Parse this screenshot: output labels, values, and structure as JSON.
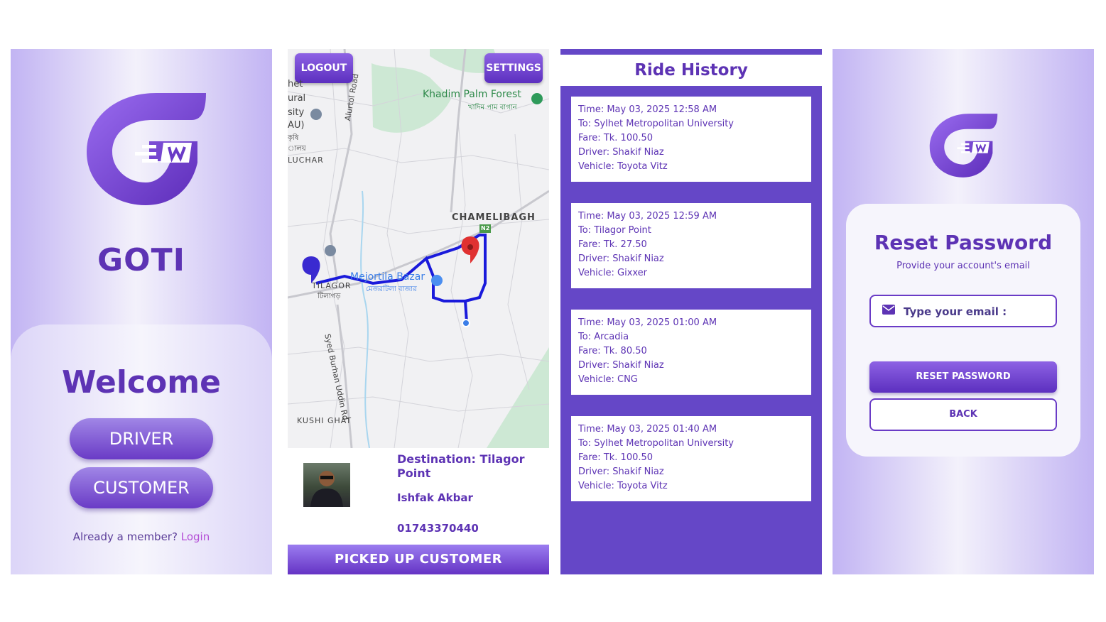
{
  "welcome_screen": {
    "brand": "GOTI",
    "heading": "Welcome",
    "driver_label": "DRIVER",
    "customer_label": "CUSTOMER",
    "member_prompt": "Already a member?",
    "login_link": "Login"
  },
  "map_screen": {
    "logout_label": "LOGOUT",
    "settings_label": "SETTINGS",
    "map_labels": {
      "forest": "Khadim Palm Forest",
      "forest_bn": "খাদিম পাম বাগান",
      "area1": "CHAMELIBAGH",
      "bazar": "Mejortila Bazar",
      "bazar_bn": "মেজরটিলা বাজার",
      "area2": "TILAGOR",
      "area2_bn": "টিলাগড়",
      "road1": "Alurtol Road",
      "road2": "Syed Burhan Uddin Rd",
      "area3": "KUSHI GHAT",
      "area4": "LUCHAR",
      "highway": "N2",
      "left_partial": [
        "het",
        "ural",
        "sity",
        "AU)",
        "কৃষি",
        "ালয়"
      ]
    },
    "destination": "Destination: Tilagor Point",
    "customer_name": "Ishfak Akbar",
    "phone": "01743370440",
    "pickup_label": "PICKED UP CUSTOMER"
  },
  "history_screen": {
    "title": "Ride History",
    "rides": [
      {
        "time": "Time: May 03, 2025 12:58 AM",
        "to": "To: Sylhet Metropolitan University",
        "fare": "Fare: Tk. 100.50",
        "driver": "Driver: Shakif Niaz",
        "vehicle": "Vehicle: Toyota Vitz"
      },
      {
        "time": "Time: May 03, 2025 12:59 AM",
        "to": "To: Tilagor Point",
        "fare": "Fare: Tk. 27.50",
        "driver": "Driver: Shakif Niaz",
        "vehicle": "Vehicle: Gixxer"
      },
      {
        "time": "Time: May 03, 2025 01:00 AM",
        "to": "To: Arcadia",
        "fare": "Fare: Tk. 80.50",
        "driver": "Driver: Shakif Niaz",
        "vehicle": "Vehicle: CNG"
      },
      {
        "time": "Time: May 03, 2025 01:40 AM",
        "to": "To: Sylhet Metropolitan University",
        "fare": "Fare: Tk. 100.50",
        "driver": "Driver: Shakif Niaz",
        "vehicle": "Vehicle: Toyota Vitz"
      }
    ]
  },
  "reset_screen": {
    "title": "Reset Password",
    "subtitle": "Provide your account's email",
    "email_placeholder": "Type your email :",
    "reset_label": "RESET PASSWORD",
    "back_label": "BACK"
  },
  "colors": {
    "brand_purple": "#5d33b4",
    "history_bg": "#6547c7",
    "route_blue": "#1a1adb",
    "pin_red": "#e03131"
  }
}
